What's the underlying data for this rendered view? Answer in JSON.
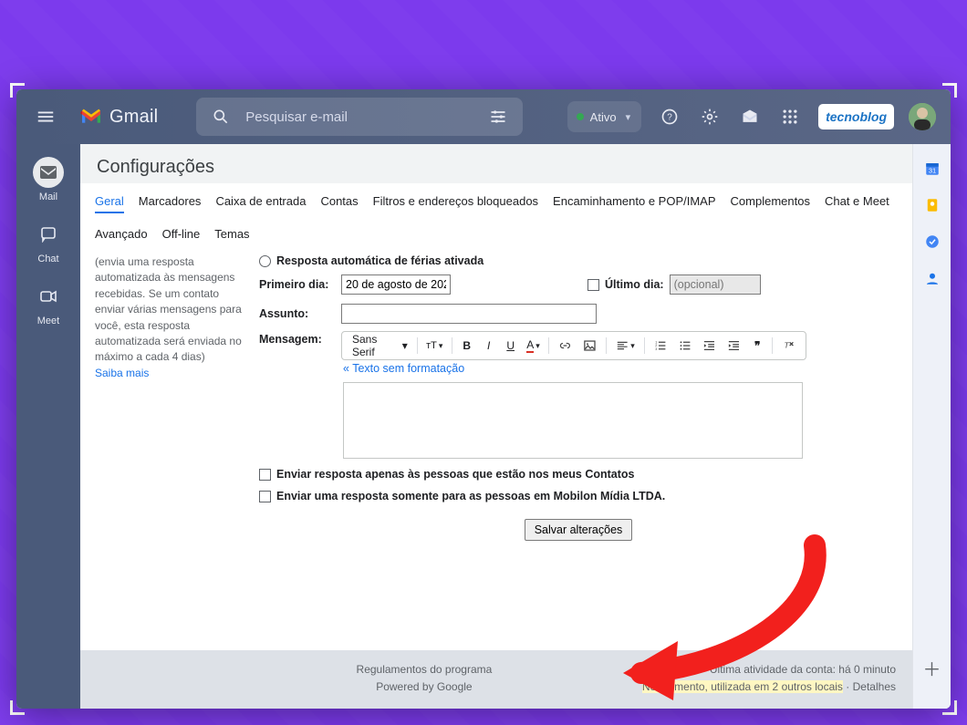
{
  "brand": {
    "name": "Gmail"
  },
  "search": {
    "placeholder": "Pesquisar e-mail"
  },
  "status": {
    "label": "Ativo"
  },
  "badge": {
    "label": "tecnoblog"
  },
  "leftnav": {
    "mail": "Mail",
    "chat": "Chat",
    "meet": "Meet"
  },
  "settings": {
    "title": "Configurações",
    "tabs": [
      "Geral",
      "Marcadores",
      "Caixa de entrada",
      "Contas",
      "Filtros e endereços bloqueados",
      "Encaminhamento e POP/IMAP",
      "Complementos",
      "Chat e Meet"
    ],
    "tabs2": [
      "Avançado",
      "Off-line",
      "Temas"
    ]
  },
  "side": {
    "desc": "(envia uma resposta automatizada às mensagens recebidas. Se um contato enviar várias mensagens para você, esta resposta automatizada será enviada no máximo a cada 4 dias)",
    "learn": "Saiba mais"
  },
  "form": {
    "vacation_on_label": "Resposta automática de férias ativada",
    "first_day_label": "Primeiro dia:",
    "first_day_value": "20 de agosto de 202",
    "last_day_label": "Último dia:",
    "last_day_placeholder": "(opcional)",
    "subject_label": "Assunto:",
    "message_label": "Mensagem:",
    "font_family": "Sans Serif",
    "plain_text_link": "« Texto sem formatação",
    "only_contacts": "Enviar resposta apenas às pessoas que estão nos meus Contatos",
    "only_domain": "Enviar uma resposta somente para as pessoas em Mobilon Mídia LTDA.",
    "save_button": "Salvar alterações"
  },
  "footer": {
    "program_rules": "Regulamentos do programa",
    "powered_by": "Powered by Google",
    "last_activity": "Última atividade da conta: há 0 minuto",
    "usage_prefix": "No momento, utilizada em 2 outros locais",
    "details": "Detalhes"
  }
}
